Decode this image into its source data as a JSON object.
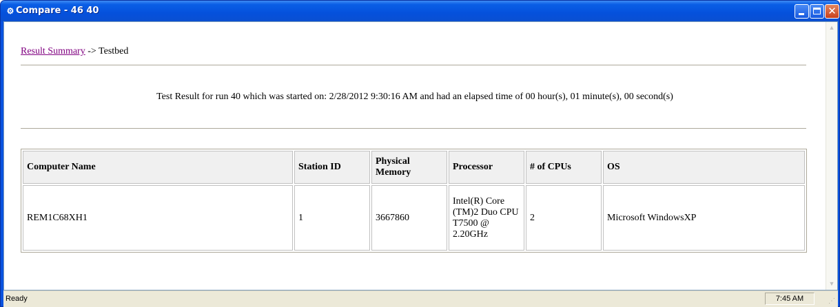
{
  "window": {
    "title": "Compare - 46 40",
    "icon": "app-icon",
    "controls": [
      "minimize-icon",
      "maximize-icon",
      "close-icon"
    ],
    "accent": "#0a53df"
  },
  "breadcrumb": {
    "link_label": "Result Summary",
    "separator_and_current": " -> Testbed",
    "link_color": "#800080"
  },
  "summary": {
    "text": "Test Result for run 40 which was started on: 2/28/2012 9:30:16 AM and had an elapsed time of 00 hour(s), 01 minute(s), 00 second(s)"
  },
  "table": {
    "headers": [
      "Computer Name",
      "Station ID",
      "Physical Memory",
      "Processor",
      "# of CPUs",
      "OS"
    ],
    "rows": [
      [
        "REM1C68XH1",
        "1",
        "3667860",
        "Intel(R) Core (TM)2 Duo CPU T7500 @ 2.20GHz",
        "2",
        "Microsoft WindowsXP"
      ]
    ]
  },
  "statusbar": {
    "status": "Ready",
    "time": "7:45 AM"
  }
}
